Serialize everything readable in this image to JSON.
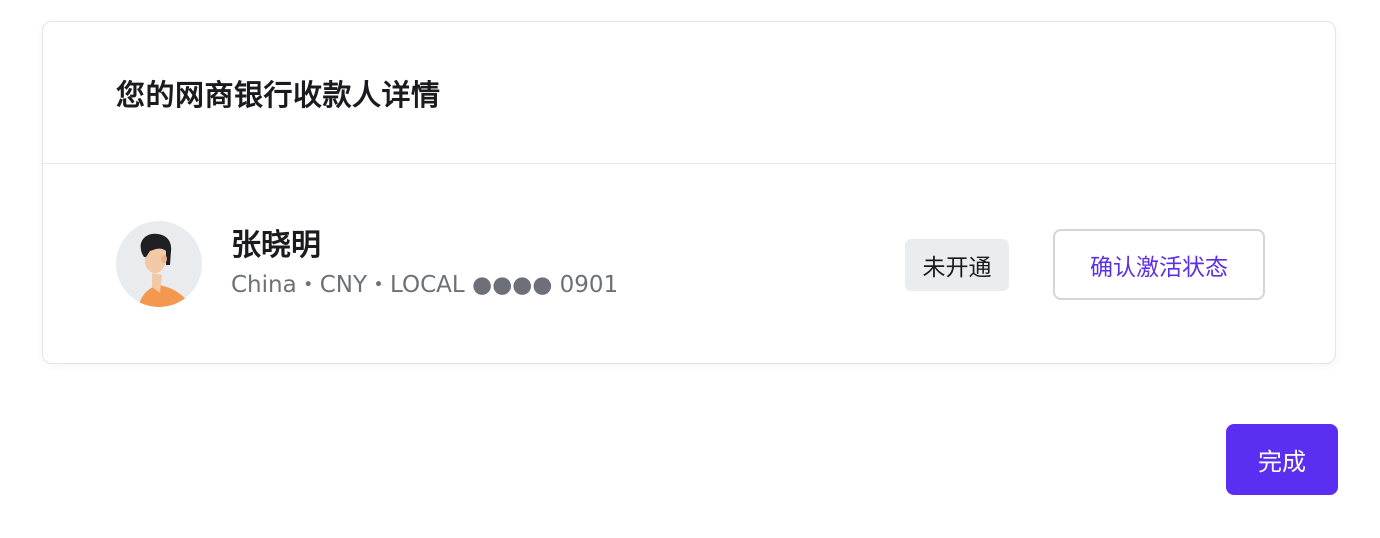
{
  "card": {
    "title": "您的网商银行收款人详情"
  },
  "payee": {
    "name": "张晓明",
    "meta": "China・CNY・LOCAL ●●●● 0901",
    "avatar_icon": "person-avatar-icon"
  },
  "status": {
    "label": "未开通"
  },
  "actions": {
    "confirm_label": "确认激活状态",
    "done_label": "完成"
  },
  "colors": {
    "accent": "#5b2ff2",
    "link_text": "#5b2fe6",
    "badge_bg": "#ebecef",
    "avatar_shirt": "#f4974f"
  }
}
